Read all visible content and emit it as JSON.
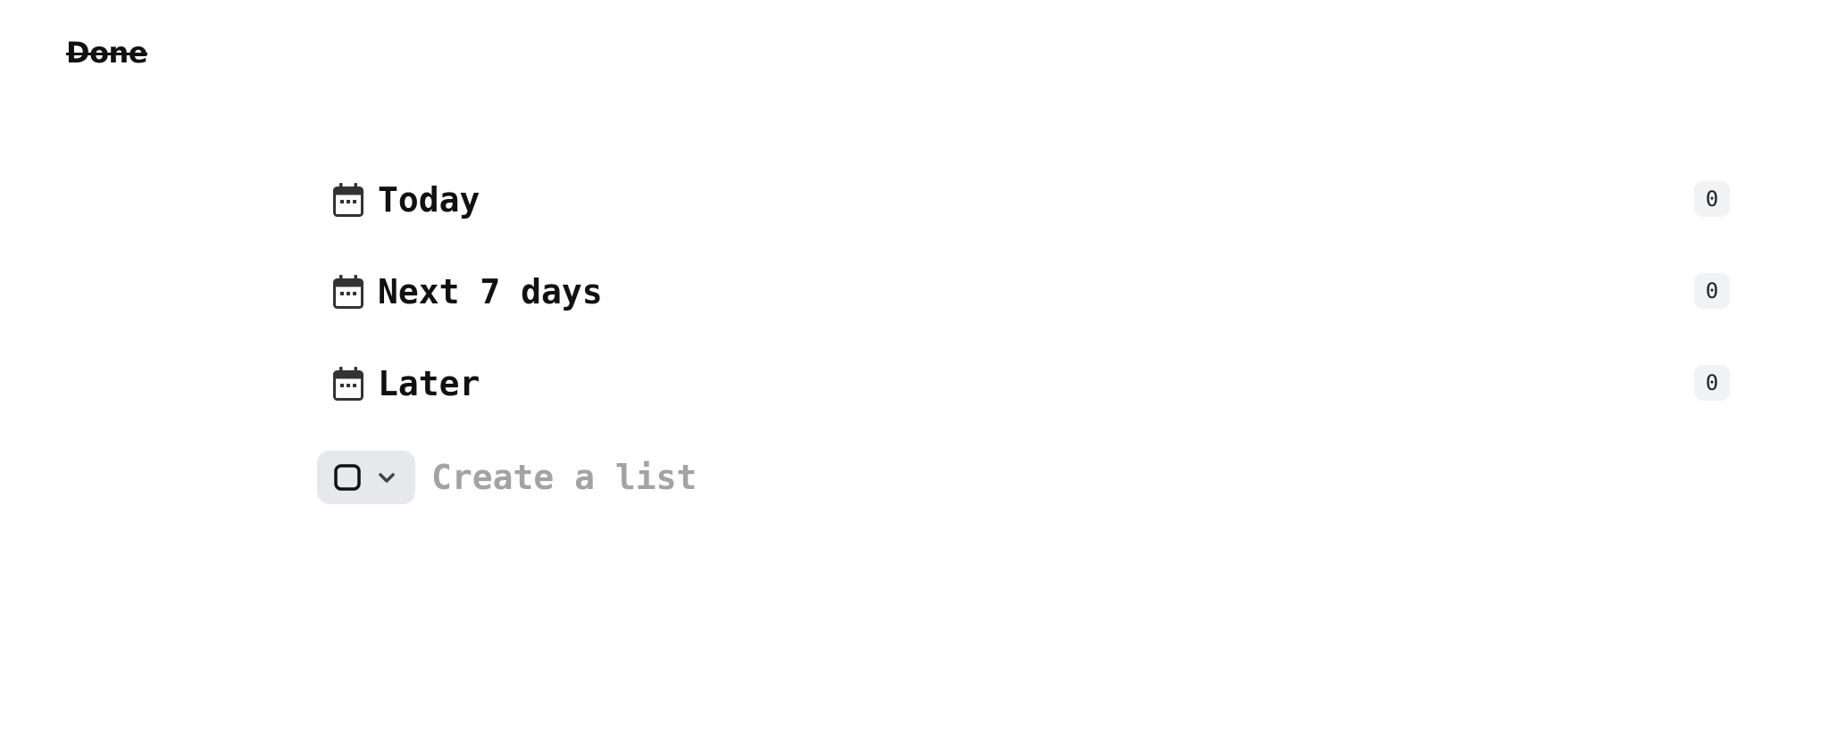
{
  "app": {
    "logo_text": "Done"
  },
  "lists": [
    {
      "label": "Today",
      "count": "0",
      "icon": "calendar-icon"
    },
    {
      "label": "Next 7 days",
      "count": "0",
      "icon": "calendar-icon"
    },
    {
      "label": "Later",
      "count": "0",
      "icon": "calendar-icon"
    }
  ],
  "create_list": {
    "placeholder": "Create a list",
    "value": "",
    "type_icon": "checkbox-square-icon",
    "dropdown_icon": "chevron-down-icon"
  },
  "colors": {
    "text": "#111111",
    "badge_bg": "#f1f2f3",
    "picker_bg": "#e6e8eb",
    "placeholder": "#a3a3a3"
  }
}
